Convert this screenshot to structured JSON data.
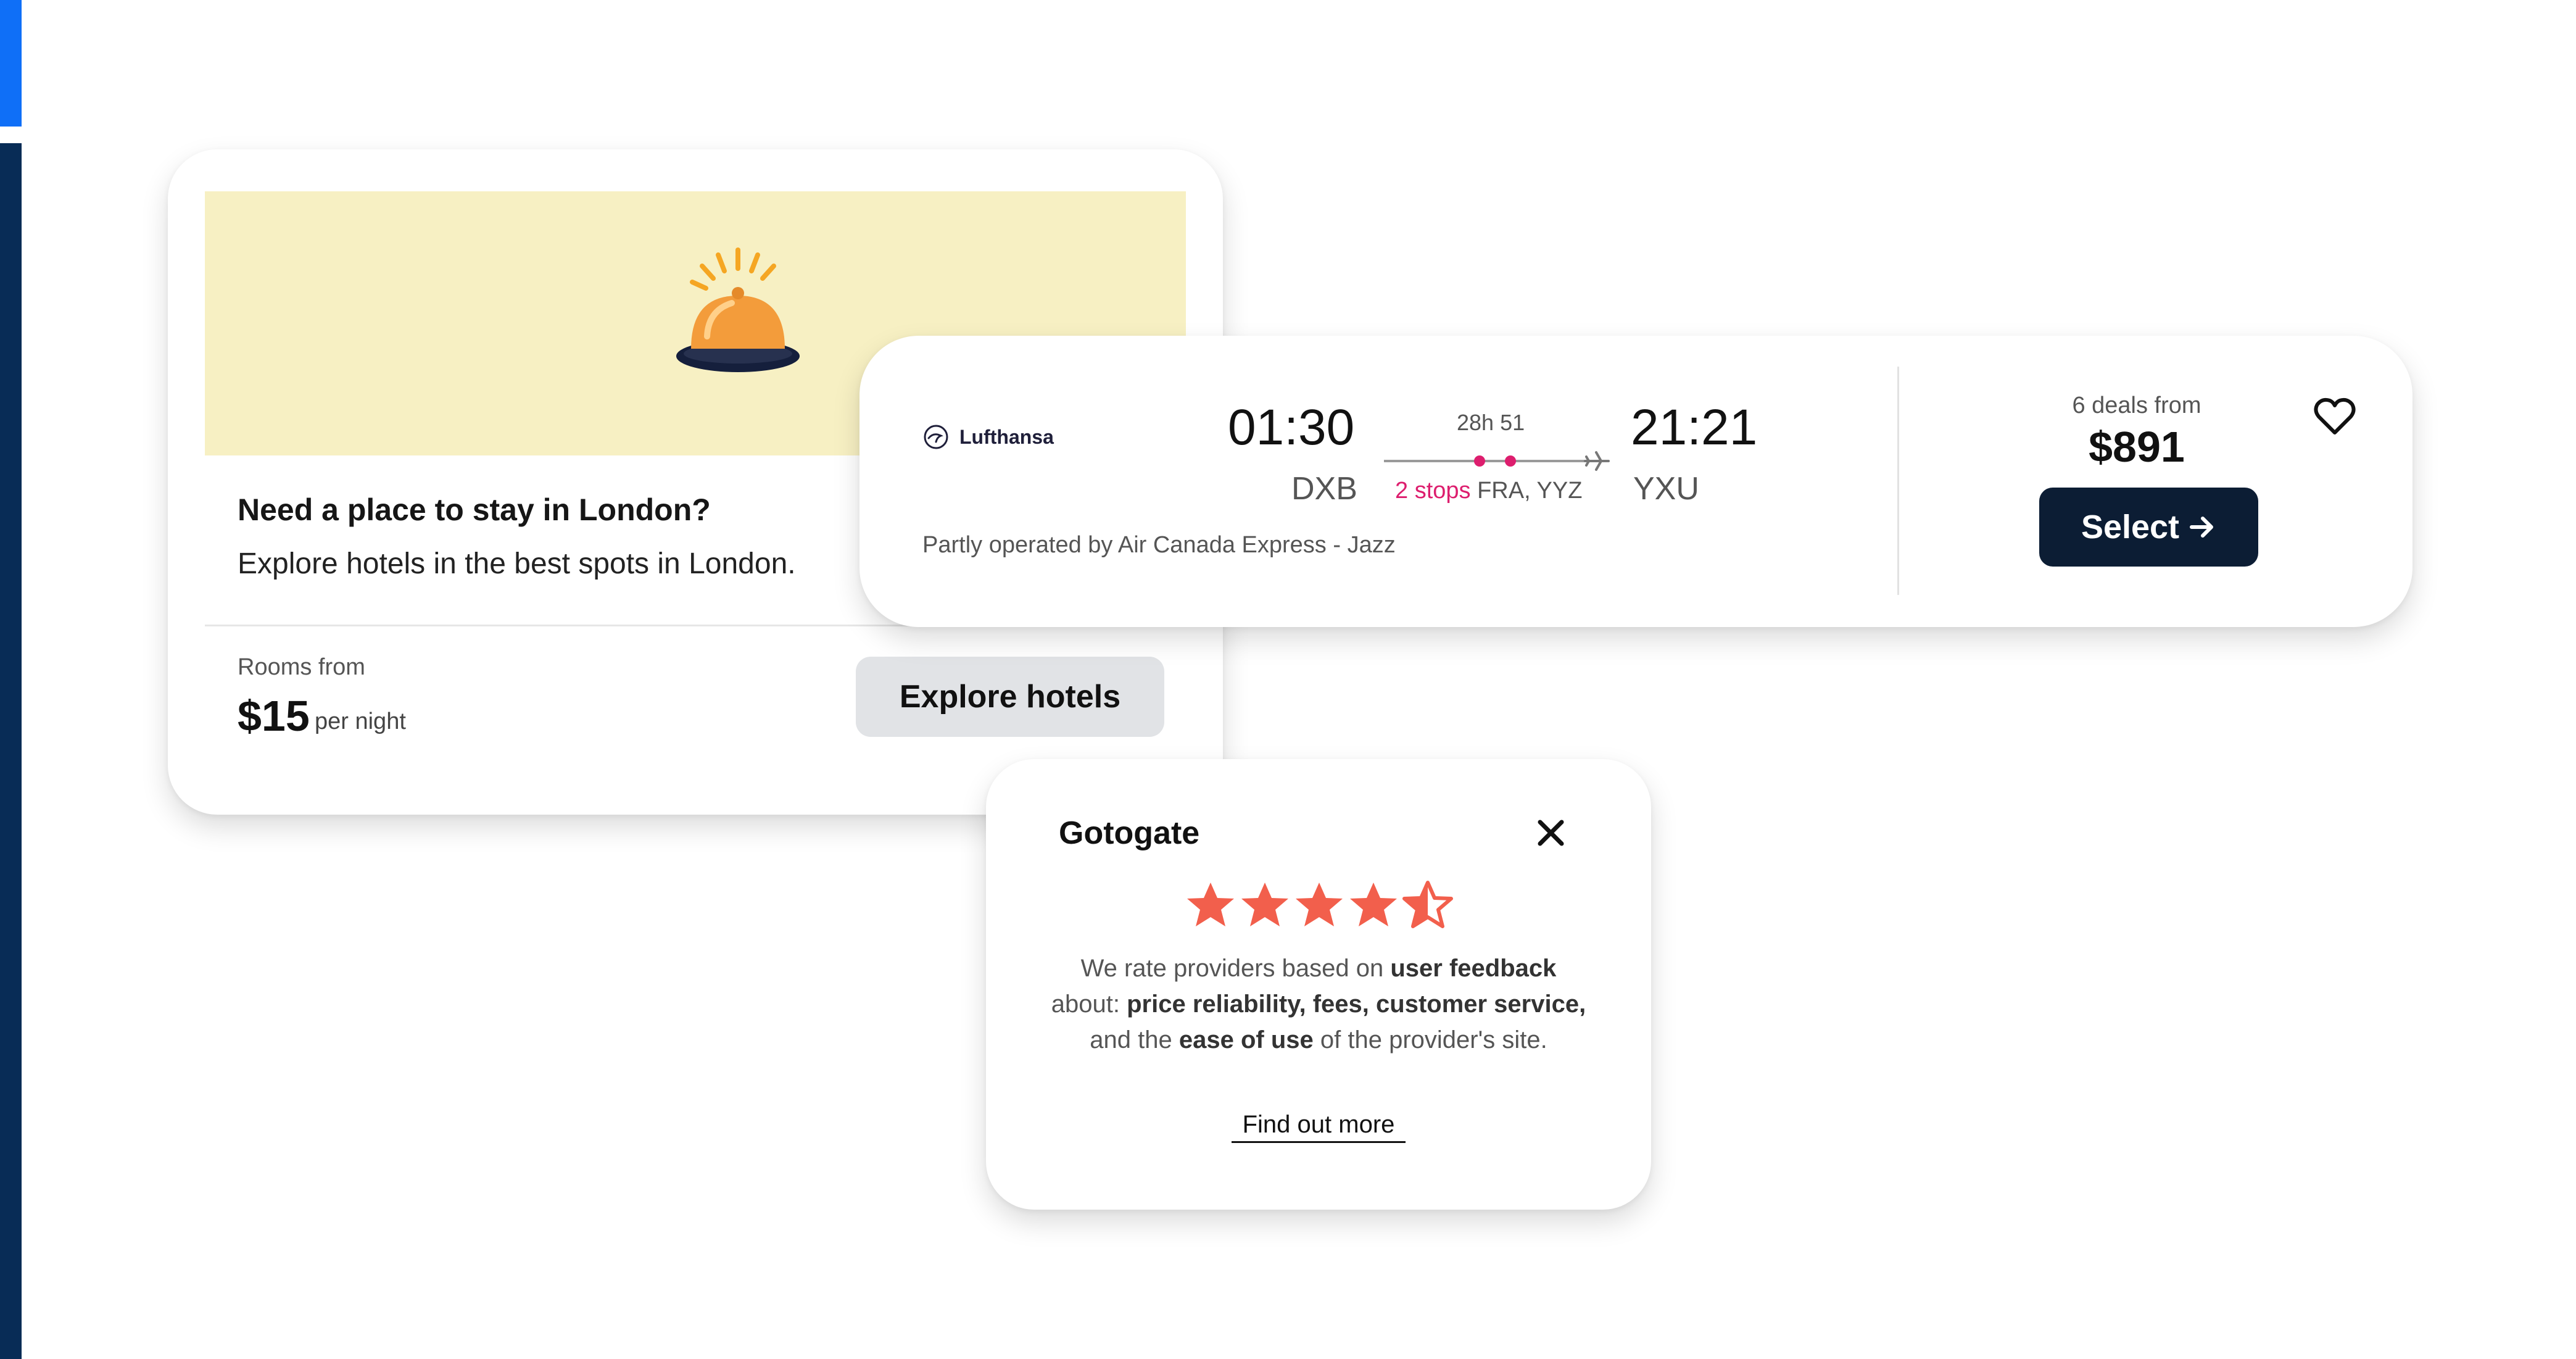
{
  "colors": {
    "hotel_banner_bg": "#f7f0c3",
    "stops_accent": "#dd1e6e",
    "select_button_bg": "#0c1d34",
    "star_color": "#f25f4c",
    "explore_button_bg": "#e1e3e6",
    "left_bar_top": "#0f6ff7",
    "left_bar": "#082c56"
  },
  "hotel_card": {
    "icon": "service-bell-icon",
    "title": "Need a place to stay in London?",
    "subtitle": "Explore hotels in the best spots in London.",
    "rooms_from_label": "Rooms from",
    "price": "$15",
    "per_night_label": "per night",
    "explore_button": "Explore hotels"
  },
  "flight_card": {
    "airline": "Lufthansa",
    "airline_icon": "lufthansa-crane-icon",
    "departure_time": "01:30",
    "departure_code": "DXB",
    "arrival_time": "21:21",
    "arrival_code": "YXU",
    "duration": "28h 51",
    "stops_count": "2 stops",
    "stops_airports": "FRA, YYZ",
    "operated_by": "Partly operated by Air Canada Express - Jazz",
    "deals_label": "6 deals from",
    "price": "$891",
    "select_button": "Select",
    "select_icon": "arrow-right-icon",
    "favorite_icon": "heart-icon"
  },
  "rating_popup": {
    "provider": "Gotogate",
    "rating": 4.5,
    "rating_max": 5,
    "close_icon": "close-icon",
    "desc_1": "We rate providers based on",
    "desc_b1": "user feedback",
    "desc_2": "about:",
    "desc_b2": "price reliability, fees, customer service,",
    "desc_3": "and the",
    "desc_b3": "ease of use",
    "desc_4": "of the provider's site.",
    "find_out_more": "Find out more"
  }
}
